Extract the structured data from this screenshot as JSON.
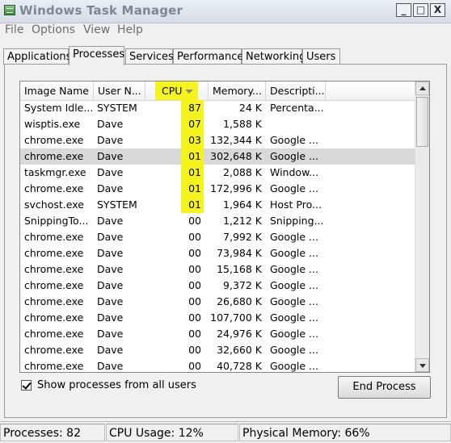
{
  "window": {
    "title": "Windows Task Manager",
    "icon": "task-manager-icon",
    "controls": {
      "minimize": "_",
      "maximize": "□",
      "close": "X"
    }
  },
  "menu": [
    "File",
    "Options",
    "View",
    "Help"
  ],
  "tabs": [
    "Applications",
    "Processes",
    "Services",
    "Performance",
    "Networking",
    "Users"
  ],
  "active_tab": "Processes",
  "columns": {
    "name": "Image Name",
    "user": "User N...",
    "cpu": "CPU",
    "memory": "Memory...",
    "desc": "Descripti..."
  },
  "sort": {
    "column": "CPU",
    "direction": "descending"
  },
  "highlight_color": "#f5f51d",
  "rows": [
    {
      "name": "System Idle...",
      "user": "SYSTEM",
      "cpu": "87",
      "mem": "24 K",
      "desc": "Percenta..."
    },
    {
      "name": "wisptis.exe",
      "user": "Dave",
      "cpu": "07",
      "mem": "1,588 K",
      "desc": ""
    },
    {
      "name": "chrome.exe",
      "user": "Dave",
      "cpu": "03",
      "mem": "132,344 K",
      "desc": "Google ..."
    },
    {
      "name": "chrome.exe",
      "user": "Dave",
      "cpu": "01",
      "mem": "302,648 K",
      "desc": "Google ..."
    },
    {
      "name": "taskmgr.exe",
      "user": "Dave",
      "cpu": "01",
      "mem": "2,088 K",
      "desc": "Window..."
    },
    {
      "name": "chrome.exe",
      "user": "Dave",
      "cpu": "01",
      "mem": "172,996 K",
      "desc": "Google ..."
    },
    {
      "name": "svchost.exe",
      "user": "SYSTEM",
      "cpu": "01",
      "mem": "1,964 K",
      "desc": "Host Pro..."
    },
    {
      "name": "SnippingTo...",
      "user": "Dave",
      "cpu": "00",
      "mem": "1,212 K",
      "desc": "Snipping..."
    },
    {
      "name": "chrome.exe",
      "user": "Dave",
      "cpu": "00",
      "mem": "7,992 K",
      "desc": "Google ..."
    },
    {
      "name": "chrome.exe",
      "user": "Dave",
      "cpu": "00",
      "mem": "73,984 K",
      "desc": "Google ..."
    },
    {
      "name": "chrome.exe",
      "user": "Dave",
      "cpu": "00",
      "mem": "15,168 K",
      "desc": "Google ..."
    },
    {
      "name": "chrome.exe",
      "user": "Dave",
      "cpu": "00",
      "mem": "9,372 K",
      "desc": "Google ..."
    },
    {
      "name": "chrome.exe",
      "user": "Dave",
      "cpu": "00",
      "mem": "26,680 K",
      "desc": "Google ..."
    },
    {
      "name": "chrome.exe",
      "user": "Dave",
      "cpu": "00",
      "mem": "107,700 K",
      "desc": "Google ..."
    },
    {
      "name": "chrome.exe",
      "user": "Dave",
      "cpu": "00",
      "mem": "24,976 K",
      "desc": "Google ..."
    },
    {
      "name": "chrome.exe",
      "user": "Dave",
      "cpu": "00",
      "mem": "32,660 K",
      "desc": "Google ..."
    },
    {
      "name": "chrome.exe",
      "user": "Dave",
      "cpu": "00",
      "mem": "40,728 K",
      "desc": "Google ..."
    }
  ],
  "selected_row": 3,
  "highlighted_cpu_rows": [
    0,
    1,
    2,
    3,
    4,
    5,
    6
  ],
  "show_all_users": {
    "label": "Show processes from all users",
    "checked": true
  },
  "end_process_label": "End Process",
  "status": {
    "processes": "Processes: 82",
    "cpu": "CPU Usage: 12%",
    "memory": "Physical Memory: 66%"
  }
}
